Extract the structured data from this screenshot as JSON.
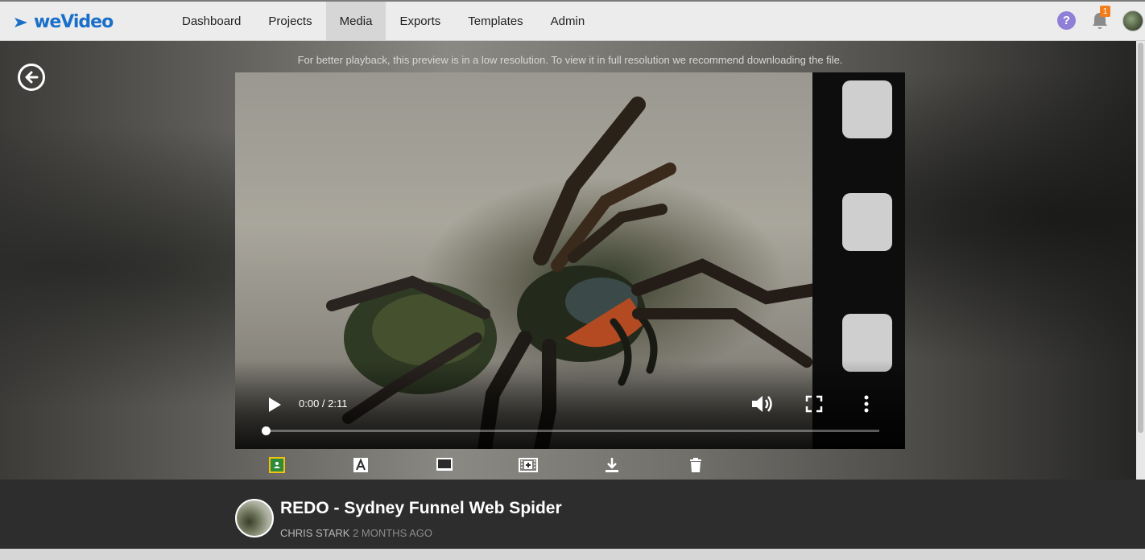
{
  "brand": {
    "name": "weVideo",
    "color": "#1a6fc9"
  },
  "nav": {
    "items": [
      {
        "label": "Dashboard",
        "active": false
      },
      {
        "label": "Projects",
        "active": false
      },
      {
        "label": "Media",
        "active": true
      },
      {
        "label": "Exports",
        "active": false
      },
      {
        "label": "Templates",
        "active": false
      },
      {
        "label": "Admin",
        "active": false
      }
    ]
  },
  "header": {
    "help_icon": "question-circle-icon",
    "help_glyph": "?",
    "notifications": {
      "icon": "bell-icon",
      "count": "1"
    },
    "avatar": "user-avatar"
  },
  "media": {
    "notice": "For better playback, this preview is in a low resolution. To view it in full resolution we recommend downloading the file.",
    "player": {
      "time": "0:00 / 2:11",
      "progress": 0.0,
      "icons": [
        "play-icon",
        "volume-icon",
        "fullscreen-icon",
        "more-vertical-icon"
      ]
    },
    "actions": [
      {
        "name": "google-classroom-icon",
        "color": "#2e8b3a"
      },
      {
        "name": "text-caption-icon"
      },
      {
        "name": "screen-icon"
      },
      {
        "name": "filmstrip-icon"
      },
      {
        "name": "download-icon"
      },
      {
        "name": "trash-icon"
      }
    ]
  },
  "info": {
    "title": "REDO - Sydney Funnel Web Spider",
    "author": "CHRIS STARK",
    "time_ago": "2 MONTHS AGO"
  }
}
